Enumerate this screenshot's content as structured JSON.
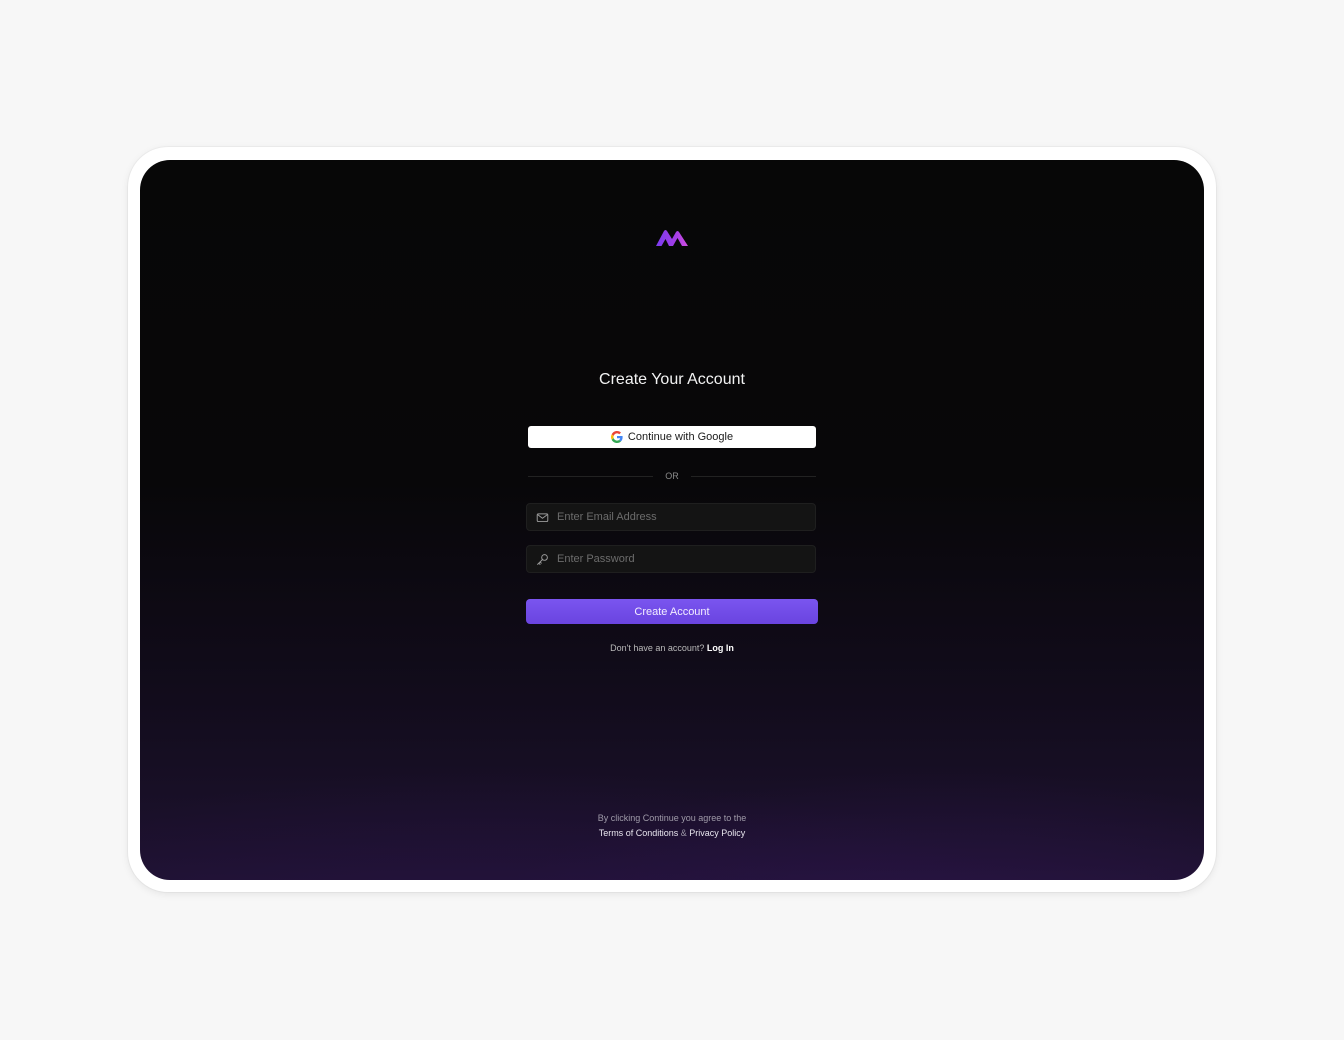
{
  "brand": {
    "logo_icon": "m-wave-logo-icon",
    "accent": "#7a55ef"
  },
  "auth": {
    "title": "Create Your Account",
    "google_label": "Continue with Google",
    "divider_label": "OR",
    "email_placeholder": "Enter Email Address",
    "password_placeholder": "Enter Password",
    "submit_label": "Create Account",
    "login_prompt": "Don't have an account?",
    "login_link": "Log In"
  },
  "legal": {
    "prefix": "By clicking Continue you agree to the",
    "terms_link": "Terms of Conditions",
    "separator": "&",
    "privacy_link": "Privacy Policy"
  }
}
